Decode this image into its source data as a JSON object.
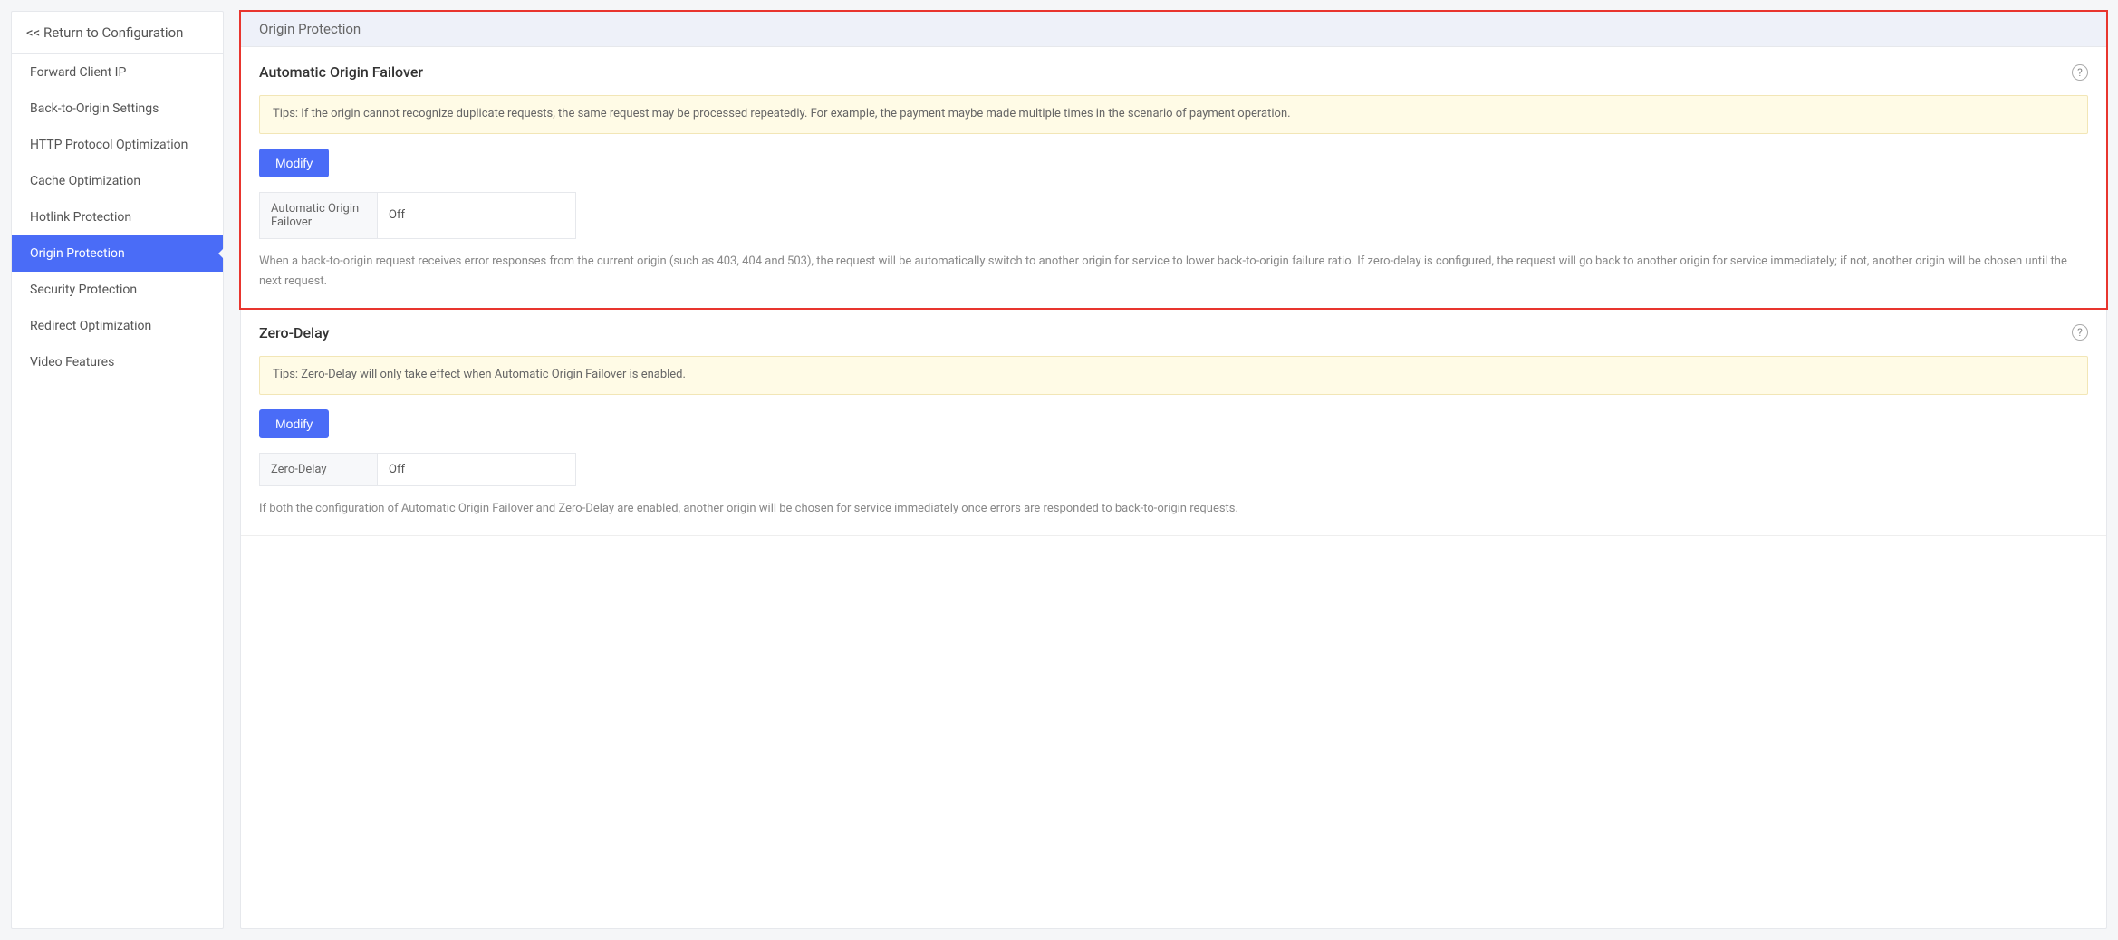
{
  "sidebar": {
    "return_label": "<< Return to Configuration",
    "items": [
      {
        "label": "Forward Client IP",
        "active": false
      },
      {
        "label": "Back-to-Origin Settings",
        "active": false
      },
      {
        "label": "HTTP Protocol Optimization",
        "active": false
      },
      {
        "label": "Cache Optimization",
        "active": false
      },
      {
        "label": "Hotlink Protection",
        "active": false
      },
      {
        "label": "Origin Protection",
        "active": true
      },
      {
        "label": "Security Protection",
        "active": false
      },
      {
        "label": "Redirect Optimization",
        "active": false
      },
      {
        "label": "Video Features",
        "active": false
      }
    ]
  },
  "main": {
    "page_title": "Origin Protection",
    "sections": {
      "failover": {
        "title": "Automatic Origin Failover",
        "tips": "Tips: If the origin cannot recognize duplicate requests, the same request may be processed repeatedly. For example, the payment maybe made multiple times in the scenario of payment operation.",
        "modify_label": "Modify",
        "kv_key": "Automatic Origin Failover",
        "kv_value": "Off",
        "desc": "When a back-to-origin request receives error responses from the current origin (such as 403, 404 and 503), the request will be automatically switch to another origin for service to lower back-to-origin failure ratio. If zero-delay is configured, the request will go back to another origin for service immediately; if not, another origin will be chosen until the next request."
      },
      "zerodelay": {
        "title": "Zero-Delay",
        "tips": "Tips: Zero-Delay will only take effect when Automatic Origin Failover is enabled.",
        "modify_label": "Modify",
        "kv_key": "Zero-Delay",
        "kv_value": "Off",
        "desc": "If both the configuration of Automatic Origin Failover and Zero-Delay are enabled, another origin will be chosen for service immediately once errors are responded to back-to-origin requests."
      }
    }
  }
}
